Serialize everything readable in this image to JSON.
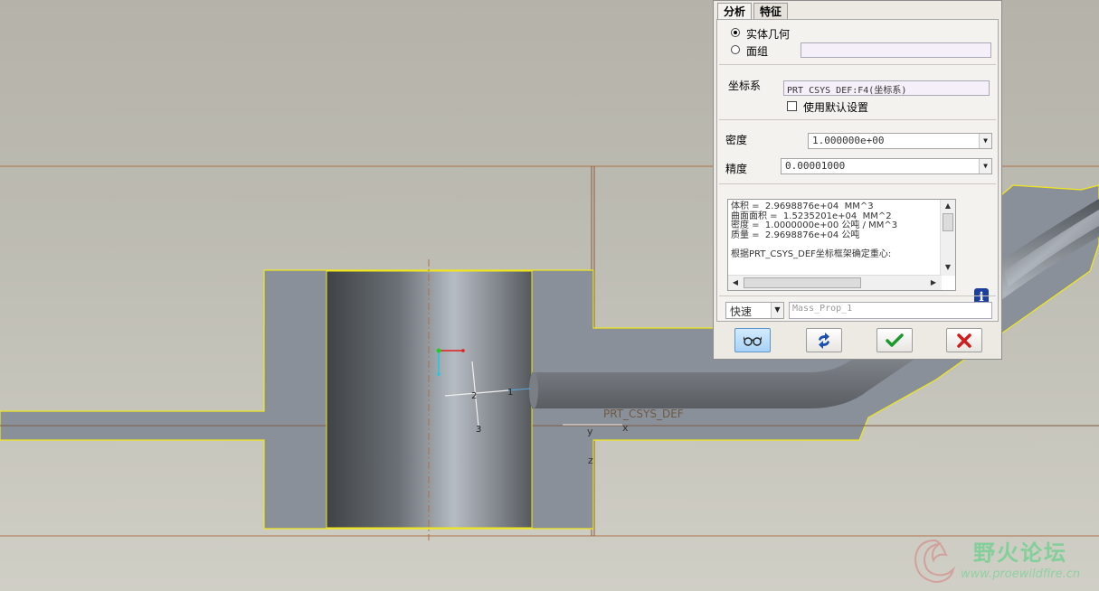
{
  "tabs": [
    "分析",
    "特征"
  ],
  "geometry": {
    "solid_label": "实体几何",
    "solid_checked": true,
    "quilt_label": "面组",
    "quilt_checked": false
  },
  "coordinate": {
    "label": "坐标系",
    "value": "PRT_CSYS_DEF:F4(坐标系)",
    "default_label": "使用默认设置",
    "default_checked": false
  },
  "density": {
    "label": "密度",
    "value": "1.000000e+00"
  },
  "accuracy": {
    "label": "精度",
    "value": "0.00001000"
  },
  "results": {
    "lines": [
      "体积 =  2.9698876e+04  MM^3",
      "曲面面积 =  1.5235201e+04  MM^2",
      "密度 =  1.0000000e+00 公吨 / MM^3",
      "质量 =  2.9698876e+04 公吨"
    ],
    "note": "根据PRT_CSYS_DEF坐标框架确定重心:"
  },
  "mode": {
    "value": "快速"
  },
  "name_field": {
    "placeholder": "Mass_Prop_1"
  },
  "buttons": {
    "preview": "glasses-icon",
    "repeat": "refresh-icon",
    "ok": "checkmark-icon",
    "cancel": "close-icon",
    "info": "i"
  },
  "canvas": {
    "csys_label": "PRT_CSYS_DEF",
    "axis_x": "x",
    "axis_y": "y",
    "axis_z": "z",
    "mark_1": "1",
    "mark_2": "2",
    "mark_3": "3"
  },
  "watermark": {
    "title": "野火论坛",
    "url": "www.proewildfire.cn"
  },
  "colors": {
    "part_fill": "#8a9099",
    "part_edge": "#f0e61c",
    "datum_line": "#b0704a",
    "dialog_bg": "#eceae3",
    "ok_green": "#1b9a2b",
    "cancel_red": "#d21c1c"
  }
}
